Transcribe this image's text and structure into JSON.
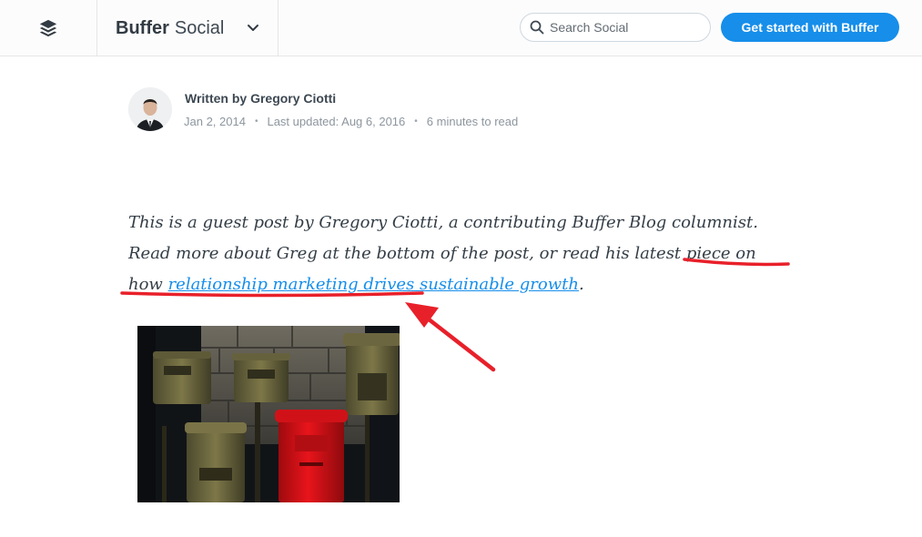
{
  "header": {
    "brand_bold": "Buffer",
    "brand_light": "Social",
    "search_placeholder": "Search Social",
    "cta_label": "Get started with Buffer"
  },
  "author": {
    "written_by": "Written by Gregory Ciotti",
    "date": "Jan 2, 2014",
    "separator": "•",
    "last_updated": "Last updated: Aug 6, 2016",
    "read_time": "6 minutes to read"
  },
  "intro": {
    "text_before_link": "This is a guest post by Gregory Ciotti, a contributing Buffer Blog columnist. Read more about Greg at the bottom of the post, or read his latest piece on how ",
    "link_text": "relationship marketing drives sustainable growth",
    "text_after_link": "."
  },
  "colors": {
    "accent": "#168eea",
    "annotation": "#e8202a"
  },
  "icons": {
    "logo": "buffer-layers-icon",
    "chevron": "chevron-down-icon",
    "search": "search-icon"
  }
}
